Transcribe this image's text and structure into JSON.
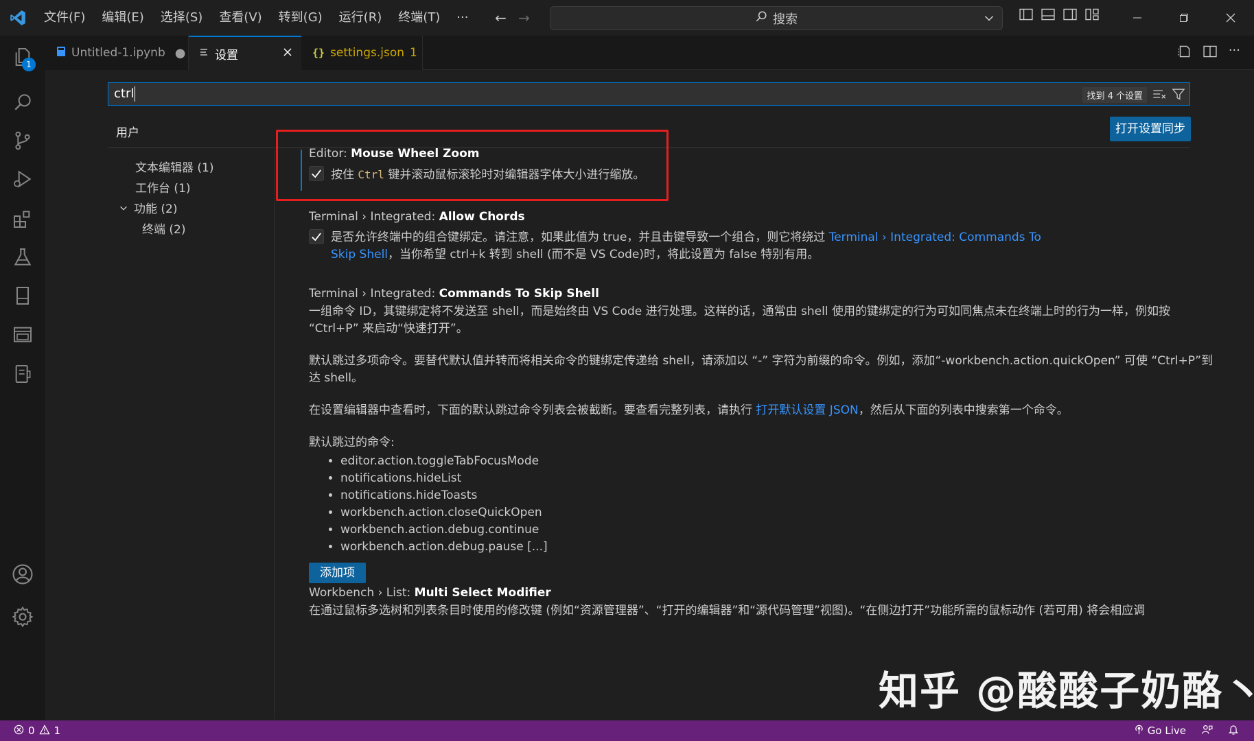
{
  "menubar": [
    "文件(F)",
    "编辑(E)",
    "选择(S)",
    "查看(V)",
    "转到(G)",
    "运行(R)",
    "终端(T)",
    "···"
  ],
  "command_center": {
    "placeholder": "搜索"
  },
  "activity": {
    "explorer_badge": "1"
  },
  "tabs": [
    {
      "label": "Untitled-1.ipynb",
      "icon": "notebook-icon",
      "modified": true
    },
    {
      "label": "设置",
      "icon": "settings-file-icon",
      "active": true
    },
    {
      "label": "settings.json",
      "icon": "json-braces-icon",
      "problems": "1"
    }
  ],
  "search": {
    "value": "ctrl",
    "found": "找到 4 个设置"
  },
  "scope_tab": "用户",
  "sync_button": "打开设置同步",
  "toc": [
    {
      "label": "文本编辑器 (1)"
    },
    {
      "label": "工作台 (1)"
    },
    {
      "label": "功能 (2)",
      "expanded": true
    },
    {
      "label": "终端 (2)"
    }
  ],
  "settings": {
    "mouse_wheel_zoom": {
      "category": "Editor: ",
      "key": "Mouse Wheel Zoom",
      "desc_before": "按住 ",
      "desc_code": "Ctrl",
      "desc_after": " 键并滚动鼠标滚轮时对编辑器字体大小进行缩放。",
      "checked": true
    },
    "allow_chords": {
      "category": "Terminal › Integrated: ",
      "key": "Allow Chords",
      "desc_before": "是否允许终端中的组合键绑定。请注意，如果此值为 true，并且击键导致一个组合，则它将绕过 ",
      "desc_link": "Terminal › Integrated: Commands To Skip Shell",
      "desc_after": "，当你希望 ctrl+k 转到 shell (而不是 VS Code)时，将此设置为 false 特别有用。",
      "checked": true
    },
    "commands_to_skip_shell": {
      "category": "Terminal › Integrated: ",
      "key": "Commands To Skip Shell",
      "p1": "一组命令 ID，其键绑定将不发送至 shell，而是始终由 VS Code 进行处理。这样的话，通常由 shell 使用的键绑定的行为可如同焦点未在终端上时的行为一样，例如按 “Ctrl+P” 来启动“快速打开”。",
      "p2": "默认跳过多项命令。要替代默认值并转而将相关命令的键绑定传递给 shell，请添加以 “-” 字符为前缀的命令。例如，添加“-workbench.action.quickOpen” 可使 “Ctrl+P”到达 shell。",
      "p3_before": "在设置编辑器中查看时，下面的默认跳过命令列表会被截断。要查看完整列表，请执行 ",
      "p3_link": "打开默认设置 JSON",
      "p3_after": "，然后从下面的列表中搜索第一个命令。",
      "list_title": "默认跳过的命令:",
      "list": [
        "editor.action.toggleTabFocusMode",
        "notifications.hideList",
        "notifications.hideToasts",
        "workbench.action.closeQuickOpen",
        "workbench.action.debug.continue",
        "workbench.action.debug.pause [...]"
      ],
      "add_button": "添加项"
    },
    "multi_select_modifier": {
      "category": "Workbench › List: ",
      "key": "Multi Select Modifier",
      "desc": "在通过鼠标多选树和列表条目时使用的修改键 (例如“资源管理器”、“打开的编辑器”和“源代码管理”视图)。“在侧边打开”功能所需的鼠标动作 (若可用) 将会相应调"
    }
  },
  "watermark": "知乎 @酸酸子奶酪丶",
  "statusbar": {
    "errors": "0",
    "warnings": "1",
    "go_live": "Go Live"
  },
  "colors": {
    "accent": "#0078d4",
    "status_bar": "#68217a",
    "highlight_box": "#e51f1f",
    "link": "#3794ff"
  }
}
